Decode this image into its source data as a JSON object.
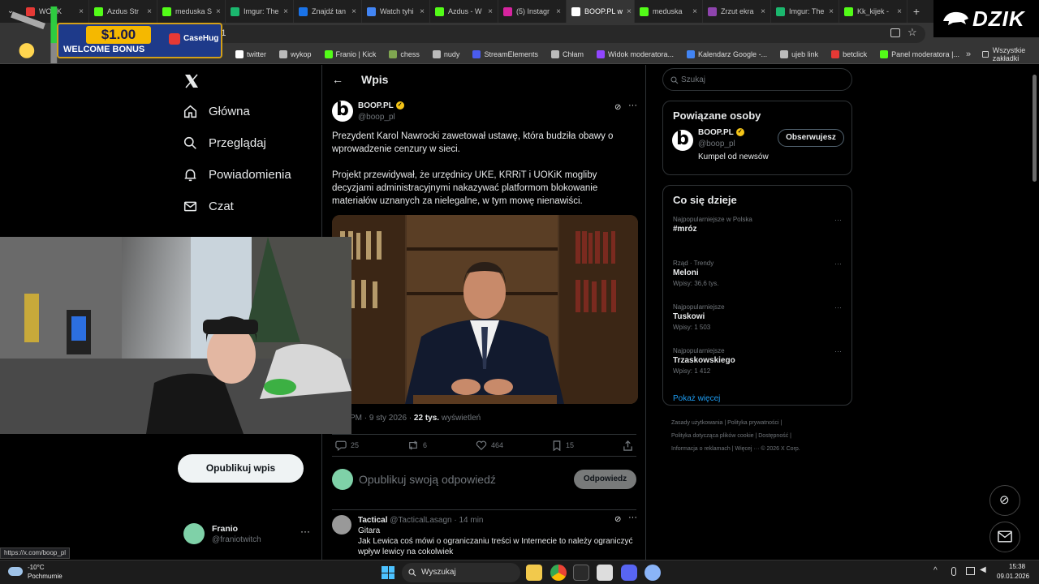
{
  "browser": {
    "tabs": [
      {
        "label": "WORK",
        "color": "#e53935"
      },
      {
        "label": "Azdus Str",
        "color": "#53fc18"
      },
      {
        "label": "meduska S",
        "color": "#53fc18"
      },
      {
        "label": "Imgur: The",
        "color": "#1bb76e"
      },
      {
        "label": "Znajdź tan",
        "color": "#1a73e8"
      },
      {
        "label": "Watch tyhi",
        "color": "#4285f4"
      },
      {
        "label": "Azdus - W",
        "color": "#53fc18"
      },
      {
        "label": "(5) Instagr",
        "color": "#d6249f"
      },
      {
        "label": "BOOP.PL w",
        "color": "#ffffff",
        "active": true
      },
      {
        "label": "meduska",
        "color": "#53fc18"
      },
      {
        "label": "Zrzut ekra",
        "color": "#8e44ad"
      },
      {
        "label": "Imgur: The",
        "color": "#1bb76e"
      },
      {
        "label": "Kk_kijek -",
        "color": "#53fc18"
      }
    ],
    "url_fragment": "3271",
    "bookmarks": [
      {
        "label": "twitter",
        "color": "#ffffff"
      },
      {
        "label": "wykop",
        "color": "#bbbbbb"
      },
      {
        "label": "Franio | Kick",
        "color": "#53fc18"
      },
      {
        "label": "chess",
        "color": "#7fa650"
      },
      {
        "label": "nudy",
        "color": "#bbbbbb"
      },
      {
        "label": "StreamElements",
        "color": "#4a5cf0"
      },
      {
        "label": "Chłam",
        "color": "#bbbbbb"
      },
      {
        "label": "Widok moderatora...",
        "color": "#9146ff"
      },
      {
        "label": "Kalendarz Google -...",
        "color": "#4285f4"
      },
      {
        "label": "ujeb link",
        "color": "#bbbbbb"
      },
      {
        "label": "betclick",
        "color": "#e53935"
      },
      {
        "label": "Panel moderatora |...",
        "color": "#53fc18"
      }
    ],
    "all_bookmarks_label": "Wszystkie zakładki",
    "status_link": "https://x.com/boop_pl"
  },
  "ad": {
    "amount": "$1.00",
    "bonus": "WELCOME BONUS",
    "brand": "CaseHug"
  },
  "overlay_logo": "DZIK",
  "nav": {
    "items": [
      {
        "label": "Główna"
      },
      {
        "label": "Przeglądaj"
      },
      {
        "label": "Powiadomienia"
      },
      {
        "label": "Czat"
      }
    ],
    "post_button": "Opublikuj wpis",
    "profile": {
      "name": "Franio",
      "handle": "@franiotwitch"
    }
  },
  "post": {
    "header_title": "Wpis",
    "author_name": "BOOP.PL",
    "author_handle": "@boop_pl",
    "text_p1": "Prezydent Karol Nawrocki zawetował ustawę, która budziła obawy o wprowadzenie cenzury w sieci.",
    "text_p2": "Projekt przewidywał, że urzędnicy UKE, KRRiT i UOKiK mogliby decyzjami administracyjnymi nakazywać platformom blokowanie materiałów uznanych za nielegalne, w tym mowę nienawiści.",
    "meta_time": "PM · 9 sty 2026 · ",
    "meta_views": "22 tys.",
    "meta_views_label": " wyświetleń",
    "replies": "25",
    "reposts": "6",
    "likes": "464",
    "bookmarks": "15",
    "reply_placeholder": "Opublikuj swoją odpowiedź",
    "reply_button": "Odpowiedz"
  },
  "comment": {
    "name": "Tactical",
    "handle": "@TacticalLasagn",
    "time": "· 14 min",
    "line1": "Gitara",
    "line2": "Jak Lewica coś mówi o ograniczaniu treści w Internecie to należy ograniczyć wpływ lewicy na cokolwiek"
  },
  "sidebar": {
    "search_placeholder": "Szukaj",
    "related_title": "Powiązane osoby",
    "related": {
      "name": "BOOP.PL",
      "handle": "@boop_pl",
      "bio": "Kumpel od newsów",
      "follow_button": "Obserwujesz"
    },
    "trends_title": "Co się dzieje",
    "trends": [
      {
        "category": "Najpopularniejsze w Polska",
        "name": "#mróz",
        "count": ""
      },
      {
        "category": "Rząd · Trendy",
        "name": "Meloni",
        "count": "Wpisy: 36,6 tys."
      },
      {
        "category": "Najpopularniejsze",
        "name": "Tuskowi",
        "count": "Wpisy: 1 503"
      },
      {
        "category": "Najpopularniejsze",
        "name": "Trzaskowskiego",
        "count": "Wpisy: 1 412"
      }
    ],
    "show_more": "Pokaż więcej",
    "footer": {
      "links1": "Zasady użytkowania  |  Polityka prywatności  |",
      "links2": "Polityka dotycząca plików cookie  |  Dostępność  |",
      "links3": "Informacja o reklamach  |  Więcej ···  © 2026 X Corp."
    }
  },
  "taskbar": {
    "weather_temp": "-10°C",
    "weather_desc": "Pochmurnie",
    "search_label": "Wyszukaj",
    "time": "15:38",
    "date": "09.01.2026"
  }
}
